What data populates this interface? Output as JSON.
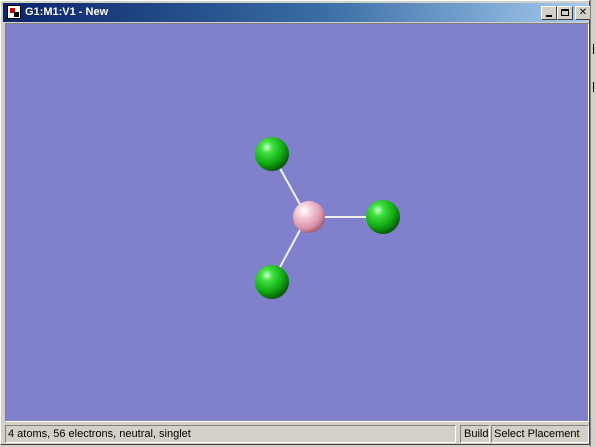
{
  "window": {
    "title": "G1:M1:V1 - New",
    "buttons": {
      "minimize": "_",
      "maximize": "□",
      "close": "✕"
    }
  },
  "viewport": {
    "background_color": "#8080cc",
    "molecule": {
      "atoms": [
        {
          "element": "Cl",
          "color": "#22cc22"
        },
        {
          "element": "B",
          "color": "#f0b8c8"
        },
        {
          "element": "Cl",
          "color": "#22cc22"
        },
        {
          "element": "Cl",
          "color": "#22cc22"
        }
      ],
      "bonds": [
        [
          1,
          0
        ],
        [
          1,
          2
        ],
        [
          1,
          3
        ]
      ]
    }
  },
  "statusbar": {
    "info": "4 atoms, 56 electrons, neutral, singlet",
    "mode": "Build",
    "placement": "Select Placement"
  },
  "colors": {
    "titlebar_start": "#0a246a",
    "titlebar_end": "#a6caf0",
    "chrome": "#d4d0c8",
    "chlorine": "#22cc22",
    "boron": "#f0b8c8"
  }
}
